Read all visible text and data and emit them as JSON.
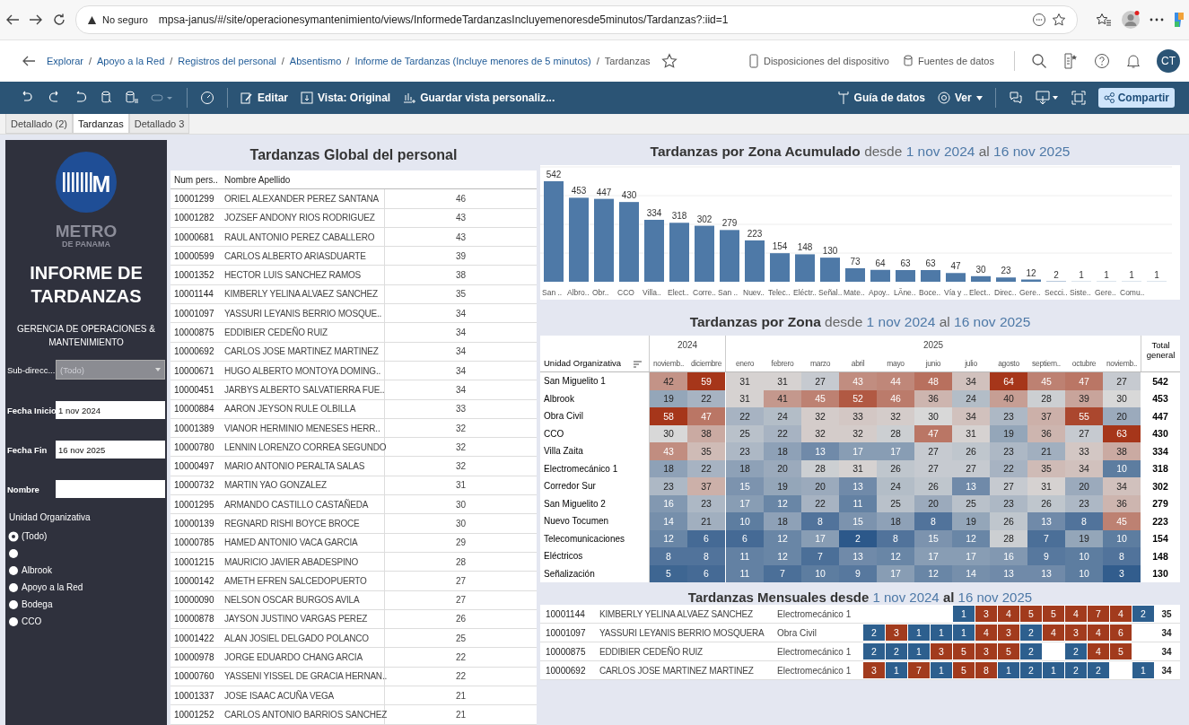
{
  "browser": {
    "security": "No seguro",
    "url": "mpsa-janus/#/site/operacionesymantenimiento/views/InformedeTardanzasIncluyemenoresde5minutos/Tardanzas?:iid=1"
  },
  "breadcrumb": {
    "links": [
      "Explorar",
      "Apoyo a la Red",
      "Registros del personal",
      "Absentismo",
      "Informe de Tardanzas (Incluye menores de 5 minutos)"
    ],
    "current": "Tardanzas",
    "separator": "/",
    "actions": [
      "Disposiciones del dispositivo",
      "Fuentes de datos"
    ],
    "user": "CT"
  },
  "toolbar": {
    "left": [
      "Editar",
      "Vista: Original",
      "Guardar vista personaliz..."
    ],
    "data_guide": "Guía de datos",
    "view": "Ver",
    "share": "Compartir"
  },
  "tabs": [
    {
      "label": "Detallado (2)",
      "selected": false
    },
    {
      "label": "Tardanzas",
      "selected": true
    },
    {
      "label": "Detallado 3",
      "selected": false
    }
  ],
  "sidebar": {
    "logo_mark": "M",
    "logo_name": "METRO",
    "logo_sub": "DE PANAMA",
    "title": "INFORME DE TARDANZAS",
    "subtitle": "GERENCIA DE OPERACIONES & MANTENIMIENTO",
    "filters": [
      {
        "label": "Sub-direcc...",
        "kind": "dropdown",
        "value": "(Todo)"
      },
      {
        "label": "Fecha Inicio",
        "kind": "text",
        "value": "1 nov 2024"
      },
      {
        "label": "Fecha Fin",
        "kind": "text",
        "value": "16 nov 2025"
      },
      {
        "label": "Nombre",
        "kind": "text"
      }
    ],
    "unit_label": "Unidad Organizativa",
    "units": [
      {
        "label": "(Todo)",
        "selected": true
      },
      {
        "selected": false
      },
      {
        "label": "Albrook",
        "selected": false
      },
      {
        "label": "Apoyo a la Red",
        "selected": false
      },
      {
        "label": "Bodega",
        "selected": false
      },
      {
        "label": "CCO",
        "selected": false
      }
    ]
  },
  "personnel": {
    "title": "Tardanzas Global del personal",
    "columns": [
      "Num pers..",
      "Nombre Apellido"
    ],
    "rows": [
      [
        "10001299",
        "ORIEL ALEXANDER PEREZ SANTANA",
        "46"
      ],
      [
        "10001282",
        "JOZSEF ANDONY RIOS RODRIGUEZ",
        "43"
      ],
      [
        "10000681",
        "RAUL ANTONIO PEREZ CABALLERO",
        "43"
      ],
      [
        "10000599",
        "CARLOS ALBERTO ARIASDUARTE",
        "39"
      ],
      [
        "10001352",
        "HECTOR LUIS SANCHEZ RAMOS",
        "38"
      ],
      [
        "10001144",
        "KIMBERLY YELINA ALVAEZ SANCHEZ",
        "35"
      ],
      [
        "10001097",
        "YASSURI LEYANIS BERRIO MOSQUE..",
        "34"
      ],
      [
        "10000875",
        "EDDIBIER CEDEÑO RUIZ",
        "34"
      ],
      [
        "10000692",
        "CARLOS JOSE MARTINEZ MARTINEZ",
        "34"
      ],
      [
        "10000671",
        "HUGO ALBERTO MONTOYA DOMING..",
        "34"
      ],
      [
        "10000451",
        "JARBYS ALBERTO SALVATIERRA FUE..",
        "34"
      ],
      [
        "10000884",
        "AARON JEYSON RULE OLBILLA",
        "33"
      ],
      [
        "10001389",
        "VIANOR HERMINIO MENESES HERR..",
        "32"
      ],
      [
        "10000780",
        "LENNIN LORENZO CORREA SEGUNDO",
        "32"
      ],
      [
        "10000497",
        "MARIO ANTONIO PERALTA SALAS",
        "32"
      ],
      [
        "10000732",
        "MARTIN YAO GONZALEZ",
        "31"
      ],
      [
        "10001295",
        "ARMANDO CASTILLO CASTAÑEDA",
        "30"
      ],
      [
        "10000139",
        "REGNARD RISHI BOYCE BROCE",
        "30"
      ],
      [
        "10000785",
        "HAMED ANTONIO VACA GARCIA",
        "29"
      ],
      [
        "10001215",
        "MAURICIO JAVIER ABADESPINO",
        "28"
      ],
      [
        "10000142",
        "AMETH EFREN SALCEDOPUERTO",
        "27"
      ],
      [
        "10000090",
        "NELSON OSCAR BURGOS AVILA",
        "27"
      ],
      [
        "10000878",
        "JAYSON JUSTINO VARGAS PEREZ",
        "26"
      ],
      [
        "10001422",
        "ALAN JOSIEL DELGADO POLANCO",
        "25"
      ],
      [
        "10000978",
        "JORGE EDUARDO CHANG ARCIA",
        "22"
      ],
      [
        "10000760",
        "YASSENI YISSEL DE GRACIA HERNAN..",
        "22"
      ],
      [
        "10001337",
        "JOSE ISAAC ACUÑA VEGA",
        "21"
      ],
      [
        "10001252",
        "CARLOS ANTONIO BARRIOS SANCHEZ",
        "21"
      ]
    ]
  },
  "zone_total": {
    "title": {
      "main": "Tardanzas por Zona Acumulado",
      "from": "desde",
      "start": "1 nov 2024",
      "to": "al",
      "end": "16 nov 2025"
    },
    "chart_data": {
      "type": "bar",
      "data_labels": true,
      "categories": [
        "San ..",
        "Albro..",
        "Obr..",
        "CCO",
        "Villa..",
        "Elect..",
        "Corre..",
        "San ..",
        "Nuev..",
        "Telec..",
        "Eléctr..",
        "Señal..",
        "Mate..",
        "Apoy..",
        "LÃne..",
        "Boce..",
        "Vía y ..",
        "Elect..",
        "Direc..",
        "Gere..",
        "Secci..",
        "Siste..",
        "Gere..",
        "Comu..",
        null
      ],
      "values": [
        542,
        453,
        447,
        430,
        334,
        318,
        302,
        279,
        223,
        154,
        148,
        130,
        73,
        64,
        63,
        63,
        47,
        30,
        23,
        12,
        2,
        1,
        1,
        1,
        1
      ]
    }
  },
  "zone_heatmap": {
    "title": {
      "main": "Tardanzas por Zona",
      "from": "desde",
      "start": "1 nov 2024",
      "to": "al",
      "end": "16 nov 2025"
    },
    "row_header": "Unidad Organizativa",
    "total_header": "Total general",
    "years": [
      {
        "label": "2024",
        "months": [
          "noviemb..",
          "diciembre"
        ]
      },
      {
        "label": "2025",
        "months": [
          "enero",
          "febrero",
          "marzo",
          "abril",
          "mayo",
          "junio",
          "julio",
          "agosto",
          "septiem..",
          "octubre",
          "noviemb.."
        ]
      }
    ],
    "rows": [
      {
        "name": "San Miguelito 1",
        "values": [
          "42",
          "59",
          "31",
          "31",
          "27",
          "43",
          "44",
          "48",
          "34",
          "64",
          "45",
          "47",
          "27"
        ],
        "total": "542"
      },
      {
        "name": "Albrook",
        "values": [
          "19",
          "22",
          "31",
          "41",
          "45",
          "52",
          "46",
          "36",
          "24",
          "40",
          "28",
          "39",
          "30"
        ],
        "total": "453"
      },
      {
        "name": "Obra Civil",
        "values": [
          "58",
          "47",
          "22",
          "24",
          "32",
          "33",
          "32",
          "30",
          "34",
          "23",
          "37",
          "55",
          "20"
        ],
        "total": "447"
      },
      {
        "name": "CCO",
        "values": [
          "30",
          "38",
          "25",
          "22",
          "32",
          "32",
          "28",
          "47",
          "31",
          "19",
          "36",
          "27",
          "63"
        ],
        "total": "430"
      },
      {
        "name": "Villa Zaita",
        "values": [
          "43",
          "35",
          "23",
          "18",
          "13",
          "17",
          "17",
          "27",
          "26",
          "23",
          "21",
          "33",
          "38"
        ],
        "total": "334"
      },
      {
        "name": "Electromecánico 1",
        "values": [
          "18",
          "22",
          "18",
          "20",
          "28",
          "31",
          "26",
          "27",
          "27",
          "22",
          "35",
          "34",
          "10"
        ],
        "total": "318"
      },
      {
        "name": "Corredor Sur",
        "values": [
          "23",
          "37",
          "15",
          "19",
          "20",
          "13",
          "24",
          "26",
          "13",
          "27",
          "31",
          "20",
          "34"
        ],
        "total": "302"
      },
      {
        "name": "San Miguelito 2",
        "values": [
          "16",
          "23",
          "17",
          "12",
          "22",
          "11",
          "25",
          "20",
          "25",
          "23",
          "26",
          "23",
          "36"
        ],
        "total": "279"
      },
      {
        "name": "Nuevo Tocumen",
        "values": [
          "14",
          "21",
          "10",
          "18",
          "8",
          "15",
          "18",
          "8",
          "19",
          "26",
          "13",
          "8",
          "45"
        ],
        "total": "223"
      },
      {
        "name": "Telecomunicaciones",
        "values": [
          "12",
          "6",
          "6",
          "12",
          "17",
          "2",
          "8",
          "15",
          "12",
          "28",
          "7",
          "19",
          "10"
        ],
        "total": "154"
      },
      {
        "name": "Eléctricos",
        "values": [
          "8",
          "8",
          "11",
          "12",
          "7",
          "13",
          "12",
          "17",
          "17",
          "16",
          "9",
          "10",
          "8"
        ],
        "total": "148"
      },
      {
        "name": "Señalización",
        "values": [
          "5",
          "6",
          "11",
          "7",
          "10",
          "9",
          "17",
          "12",
          "14",
          "13",
          "13",
          "10",
          "3"
        ],
        "total": "130"
      }
    ]
  },
  "monthly": {
    "title": {
      "main": "Tardanzas Mensuales desde",
      "start": "1 nov 2024",
      "to": "al",
      "end": "16 nov 2025"
    },
    "rows": [
      {
        "id": "10001144",
        "name": "KIMBERLY YELINA ALVAEZ SANCHEZ",
        "zone": "Electromecánico 1",
        "cells": [
          null,
          null,
          null,
          null,
          {
            "v": "1",
            "color": "#2d5f8e"
          },
          {
            "v": "3",
            "color": "#a23b1d"
          },
          {
            "v": "4",
            "color": "#a23b1d"
          },
          {
            "v": "5",
            "color": "#a23b1d"
          },
          {
            "v": "5",
            "color": "#a23b1d"
          },
          {
            "v": "4",
            "color": "#a23b1d"
          },
          {
            "v": "7",
            "color": "#a23b1d"
          },
          {
            "v": "4",
            "color": "#a23b1d"
          },
          {
            "v": "2",
            "color": "#2d5f8e"
          }
        ],
        "total": "35"
      },
      {
        "id": "10001097",
        "name": "YASSURI LEYANIS BERRIO MOSQUERA",
        "zone": "Obra Civil",
        "cells": [
          {
            "v": "2",
            "color": "#2d5f8e"
          },
          {
            "v": "3",
            "color": "#a23b1d"
          },
          {
            "v": "1",
            "color": "#2d5f8e"
          },
          {
            "v": "1",
            "color": "#2d5f8e"
          },
          {
            "v": "1",
            "color": "#2d5f8e"
          },
          {
            "v": "4",
            "color": "#a23b1d"
          },
          {
            "v": "3",
            "color": "#a23b1d"
          },
          {
            "v": "2",
            "color": "#2d5f8e"
          },
          {
            "v": "4",
            "color": "#a23b1d"
          },
          {
            "v": "3",
            "color": "#a23b1d"
          },
          {
            "v": "4",
            "color": "#a23b1d"
          },
          {
            "v": "6",
            "color": "#a23b1d"
          },
          null
        ],
        "total": "34"
      },
      {
        "id": "10000875",
        "name": "EDDIBIER CEDEÑO RUIZ",
        "zone": "Electromecánico 1",
        "cells": [
          {
            "v": "2",
            "color": "#2d5f8e"
          },
          {
            "v": "2",
            "color": "#2d5f8e"
          },
          {
            "v": "1",
            "color": "#2d5f8e"
          },
          {
            "v": "3",
            "color": "#a23b1d"
          },
          {
            "v": "5",
            "color": "#a23b1d"
          },
          {
            "v": "3",
            "color": "#a23b1d"
          },
          {
            "v": "5",
            "color": "#a23b1d"
          },
          {
            "v": "2",
            "color": "#2d5f8e"
          },
          null,
          {
            "v": "2",
            "color": "#2d5f8e"
          },
          {
            "v": "4",
            "color": "#a23b1d"
          },
          {
            "v": "5",
            "color": "#a23b1d"
          },
          null
        ],
        "total": "34"
      },
      {
        "id": "10000692",
        "name": "CARLOS JOSE MARTINEZ MARTINEZ",
        "zone": "Electromecánico 1",
        "cells": [
          {
            "v": "3",
            "color": "#a23b1d"
          },
          {
            "v": "1",
            "color": "#2d5f8e"
          },
          {
            "v": "7",
            "color": "#a23b1d"
          },
          {
            "v": "1",
            "color": "#2d5f8e"
          },
          {
            "v": "5",
            "color": "#a23b1d"
          },
          {
            "v": "8",
            "color": "#a23b1d"
          },
          {
            "v": "1",
            "color": "#2d5f8e"
          },
          {
            "v": "2",
            "color": "#2d5f8e"
          },
          {
            "v": "1",
            "color": "#2d5f8e"
          },
          {
            "v": "2",
            "color": "#2d5f8e"
          },
          {
            "v": "2",
            "color": "#2d5f8e"
          },
          null,
          {
            "v": "1",
            "color": "#2d5f8e"
          }
        ],
        "total": "34"
      }
    ]
  }
}
